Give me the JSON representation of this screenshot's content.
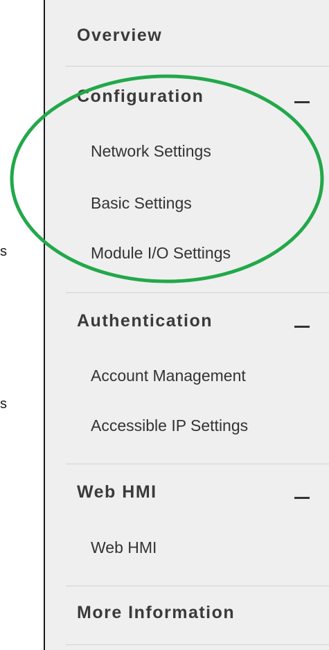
{
  "fragments": [
    "s",
    "s"
  ],
  "menu": {
    "overview": "Overview",
    "configuration": {
      "title": "Configuration",
      "items": [
        "Network Settings",
        "Basic Settings",
        "Module I/O Settings"
      ]
    },
    "authentication": {
      "title": "Authentication",
      "items": [
        "Account Management",
        "Accessible IP Settings"
      ]
    },
    "web_hmi": {
      "title": "Web HMI",
      "items": [
        "Web HMI"
      ]
    },
    "more_information": "More Information"
  },
  "colors": {
    "sidebar_bg": "#efefef",
    "text": "#333333",
    "highlight": "#22a84a"
  },
  "icons": {
    "collapse": "minus-icon"
  }
}
